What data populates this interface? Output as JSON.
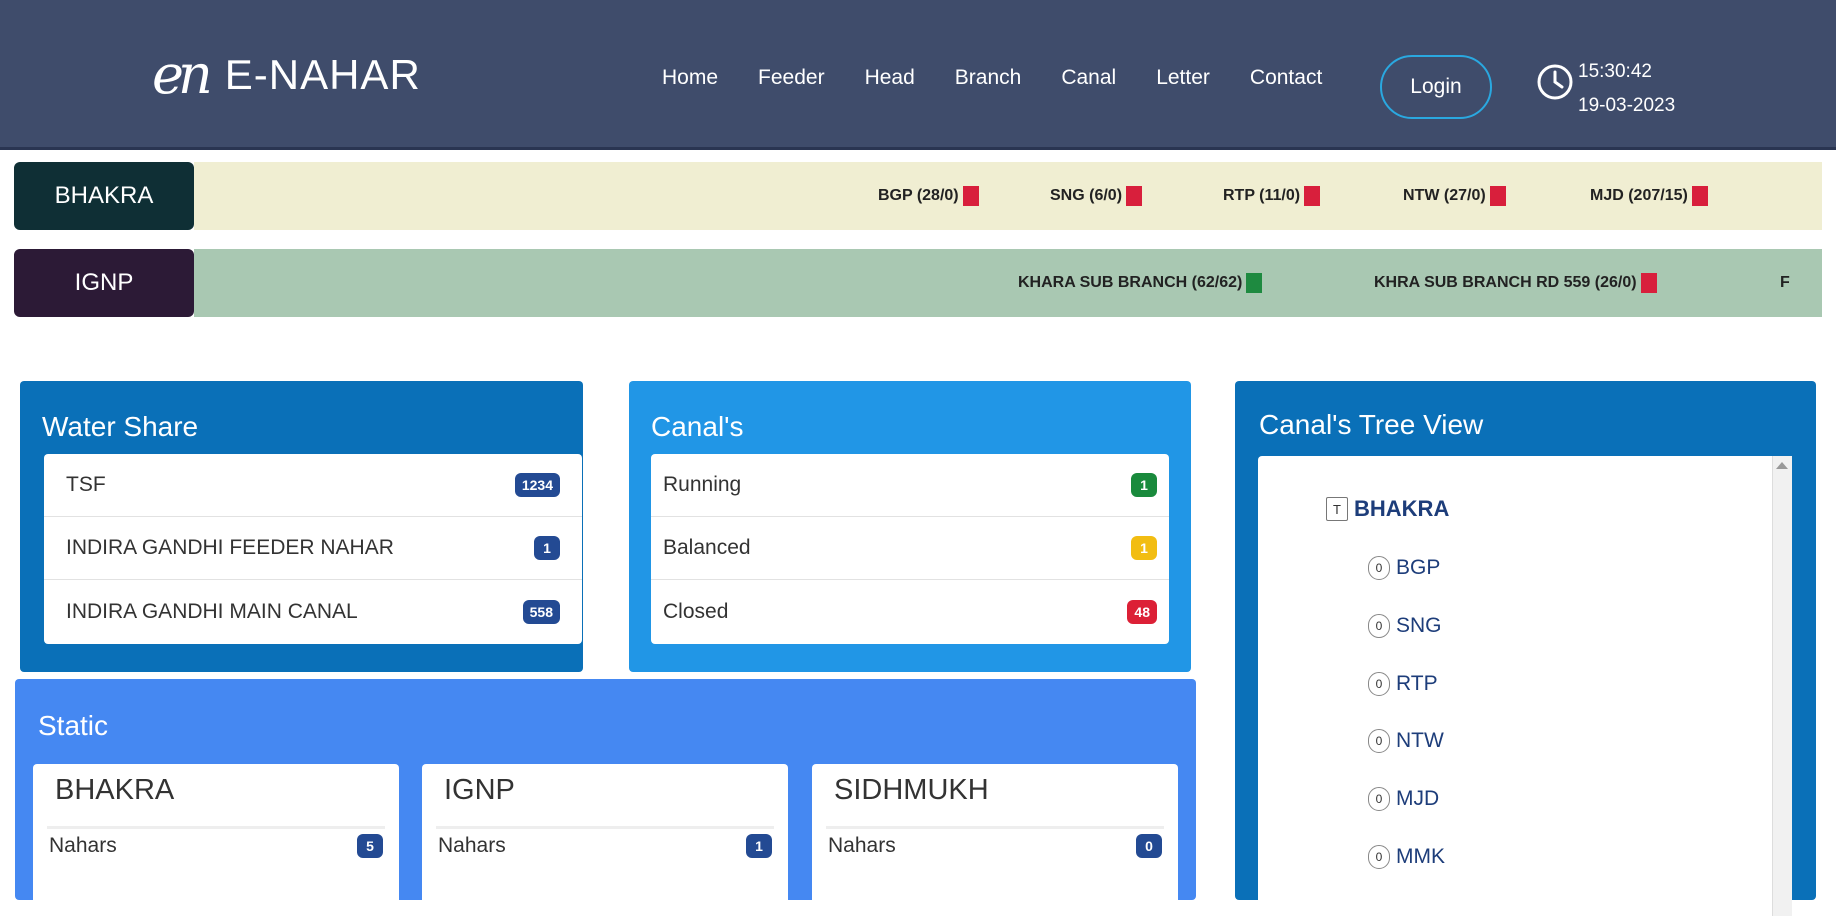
{
  "header": {
    "logo_mark": "en",
    "logo_text": "E-NAHAR",
    "nav": [
      "Home",
      "Feeder",
      "Head",
      "Branch",
      "Canal",
      "Letter",
      "Contact"
    ],
    "login_label": "Login",
    "time": "15:30:42",
    "date": "19-03-2023"
  },
  "tickers": [
    {
      "label": "BHAKRA",
      "color": "#0f2f35",
      "bg": "#f0eed2",
      "items": [
        {
          "text": "BGP (28/0)",
          "flag": "#d81f3c"
        },
        {
          "text": "SNG (6/0)",
          "flag": "#d81f3c"
        },
        {
          "text": "RTP (11/0)",
          "flag": "#d81f3c"
        },
        {
          "text": "NTW (27/0)",
          "flag": "#d81f3c"
        },
        {
          "text": "MJD (207/15)",
          "flag": "#d81f3c"
        }
      ]
    },
    {
      "label": "IGNP",
      "color": "#2c1a36",
      "bg": "#a9c8b2",
      "items": [
        {
          "text": "KHARA SUB BRANCH (62/62)",
          "flag": "#1e8a40"
        },
        {
          "text": "KHRA SUB BRANCH RD 559 (26/0)",
          "flag": "#d81f3c"
        },
        {
          "text": "F",
          "flag": ""
        }
      ]
    }
  ],
  "water_share": {
    "title": "Water Share",
    "rows": [
      {
        "label": "TSF",
        "value": "1234",
        "color": "#234a93"
      },
      {
        "label": "INDIRA GANDHI FEEDER NAHAR",
        "value": "1",
        "color": "#234a93"
      },
      {
        "label": "INDIRA GANDHI MAIN CANAL",
        "value": "558",
        "color": "#234a93"
      }
    ]
  },
  "canals": {
    "title": "Canal's",
    "rows": [
      {
        "label": "Running",
        "value": "1",
        "color": "#198a3c"
      },
      {
        "label": "Balanced",
        "value": "1",
        "color": "#f2bd12"
      },
      {
        "label": "Closed",
        "value": "48",
        "color": "#dc2036"
      }
    ]
  },
  "static": {
    "title": "Static",
    "cards": [
      {
        "title": "BHAKRA",
        "row_label": "Nahars",
        "value": "5"
      },
      {
        "title": "IGNP",
        "row_label": "Nahars",
        "value": "1"
      },
      {
        "title": "SIDHMUKH",
        "row_label": "Nahars",
        "value": "0"
      }
    ]
  },
  "tree": {
    "title": "Canal's Tree View",
    "root": "BHAKRA",
    "root_toggle": "T",
    "child_marker": "0",
    "children": [
      "BGP",
      "SNG",
      "RTP",
      "NTW",
      "MJD",
      "MMK"
    ]
  },
  "colors": {
    "header_bg": "#3f4c6b",
    "water_share_bg": "#0a70b8",
    "canals_bg": "#2196e6",
    "static_bg": "#4588f2",
    "tree_bg": "#0a70b8",
    "card_badge": "#234a93"
  }
}
